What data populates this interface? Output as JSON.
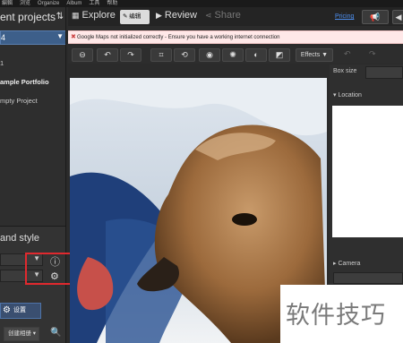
{
  "menubar": [
    "編輯",
    "浏览",
    "Organize",
    "Album",
    "工具",
    "帮助"
  ],
  "sidebar": {
    "title": "ent projects",
    "sort_icon": "sort-icon",
    "selected_project": "4",
    "projects": [
      {
        "label": "1",
        "bold": false
      },
      {
        "label": "ample Portfolio",
        "bold": true
      },
      {
        "label": "mpty Project",
        "bold": false
      }
    ],
    "style_title": "and style",
    "settings_label": "设置",
    "new_album_label": "创建相册",
    "accent": "#3d5f8a"
  },
  "nav": {
    "explore": "Explore",
    "edit": "编辑",
    "review": "Review",
    "share": "Share",
    "pricing": "Pricing"
  },
  "notice": {
    "text": "Google Maps not initialized correctly - Ensure you have a working internet connection"
  },
  "toolbar": {
    "effects_label": "Effects"
  },
  "rpanel": {
    "box_size": "Box size",
    "location": "Location",
    "camera": "Camera"
  },
  "watermark": "软件技巧"
}
